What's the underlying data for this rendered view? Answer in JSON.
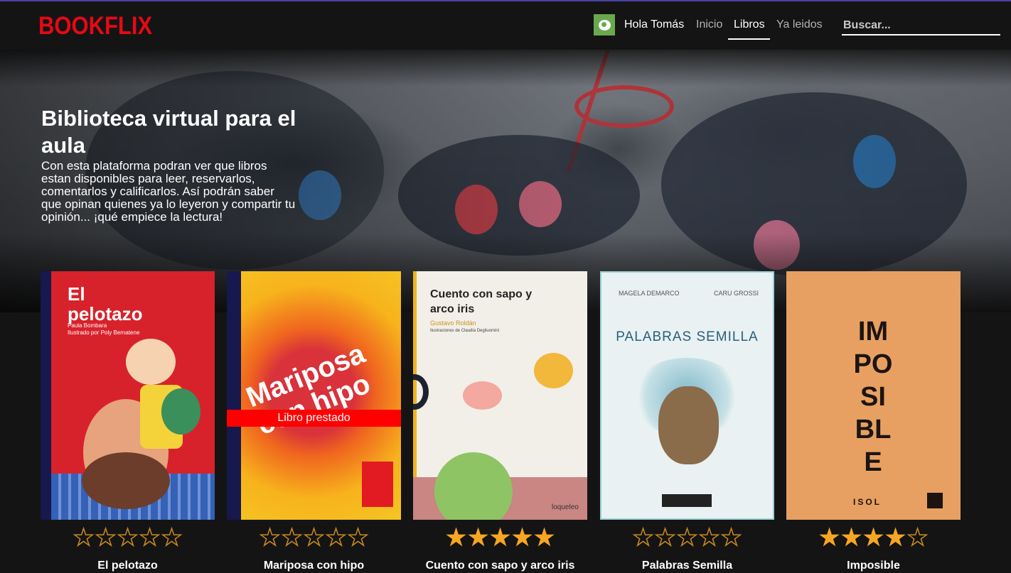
{
  "brand": {
    "name": "BOOKFLIX"
  },
  "header": {
    "greeting": "Hola Tomás",
    "nav": [
      {
        "label": "Inicio",
        "active": false
      },
      {
        "label": "Libros",
        "active": true
      },
      {
        "label": "Ya leidos",
        "active": false
      }
    ],
    "search_placeholder": "Buscar..."
  },
  "hero": {
    "title": "Biblioteca virtual para el aula",
    "text": "Con esta plataforma podran ver que libros estan disponibles para leer, reservarlos, comentarlos y calificarlos. Así podrán saber que opinan quienes ya lo leyeron y compartir tu opinión... ¡qué empiece la lectura!"
  },
  "books": [
    {
      "title": "El pelotazo",
      "rating": 0,
      "cover": {
        "title": "El pelotazo",
        "author": "Paula Bombara",
        "illustrator": "Ilustrado por Poly Bernatene"
      }
    },
    {
      "title": "Mariposa con hipo",
      "rating": 0,
      "status": "Libro prestado",
      "cover": {
        "title": "Mariposa con hipo"
      }
    },
    {
      "title": "Cuento con sapo y arco iris",
      "rating": 5,
      "cover": {
        "title": "Cuento con sapo y arco iris",
        "author": "Gustavo Roldán",
        "illustrator": "Ilustraciones de Claudia Degliuomini",
        "publisher": "loqueleo"
      }
    },
    {
      "title": "Palabras Semilla",
      "rating": 0,
      "cover": {
        "title": "PALABRAS SEMILLA",
        "author1": "MAGELA DEMARCO",
        "author2": "CARU GROSSI"
      }
    },
    {
      "title": "Imposible",
      "rating": 4,
      "cover": {
        "title": "IMPOSIBLE",
        "author": "ISOL"
      }
    }
  ],
  "colors": {
    "brand": "#e50914",
    "star_on": "#f6a623",
    "star_off": "#c98a1c",
    "lent_banner": "#ff0000"
  }
}
